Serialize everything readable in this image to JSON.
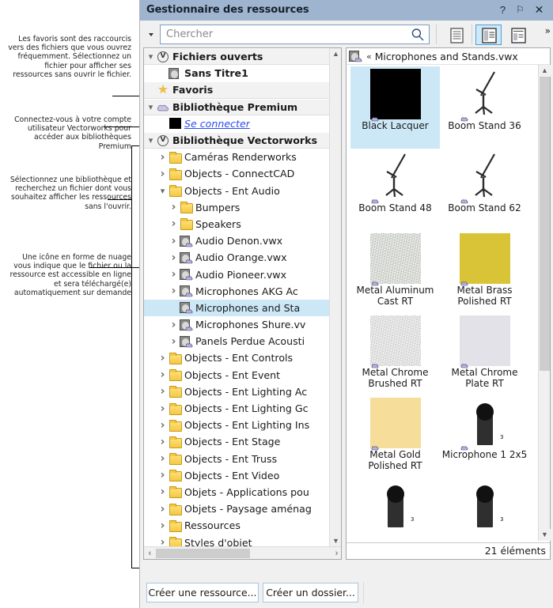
{
  "window": {
    "title": "Gestionnaire des ressources",
    "titlebar_buttons": [
      {
        "name": "help-button",
        "glyph": "?"
      },
      {
        "name": "pin-button",
        "glyph": "⚐"
      },
      {
        "name": "close-button",
        "glyph": "✕"
      }
    ]
  },
  "toolbar": {
    "search_placeholder": "Chercher",
    "search_value": "",
    "search_dropdown": "search-options-dropdown",
    "view_buttons": [
      {
        "name": "list-view-button",
        "active": false
      },
      {
        "name": "thumbnail-view-button",
        "active": true
      },
      {
        "name": "detail-view-button",
        "active": false
      }
    ],
    "overflow": "»"
  },
  "annotations": [
    {
      "id": "annot-favoris",
      "text": "Les favoris sont des raccourcis vers des fichiers que vous ouvrez fréquemment. Sélectionnez un fichier pour afficher ses ressources sans ouvrir le fichier."
    },
    {
      "id": "annot-premium",
      "text": "Connectez-vous à votre compte utilisateur Vectorworks pour accéder aux bibliothèques Premium"
    },
    {
      "id": "annot-bibliotheque",
      "text": "Sélectionnez une bibliothèque et recherchez un fichier dont vous souhaitez afficher les ressources sans l'ouvrir."
    },
    {
      "id": "annot-cloud",
      "text": "Une icône en forme de nuage vous indique que le fichier ou la ressource est accessible en ligne et sera téléchargé(e) automatiquement sur demande"
    }
  ],
  "tree": {
    "rows": [
      {
        "label": "Fichiers ouverts",
        "indent": 0,
        "twist": "open",
        "icon": "vectorworks-circle-icon",
        "group": true,
        "selected": false
      },
      {
        "label": "Sans Titre1",
        "indent": 1,
        "twist": "none",
        "icon": "vwx-document-icon",
        "group": false,
        "selected": false,
        "bold": true
      },
      {
        "label": "Favoris",
        "indent": 0,
        "twist": "none",
        "icon": "star-icon",
        "group": true,
        "selected": false
      },
      {
        "label": "Bibliothèque Premium",
        "indent": 0,
        "twist": "open",
        "icon": "cloud-icon",
        "group": true,
        "selected": false
      },
      {
        "label": "Se connecter",
        "indent": 1,
        "twist": "none",
        "icon": "black-square-icon",
        "group": false,
        "selected": false,
        "link": true
      },
      {
        "label": "Bibliothèque Vectorworks",
        "indent": 0,
        "twist": "open",
        "icon": "vectorworks-circle-icon",
        "group": true,
        "selected": false
      },
      {
        "label": "Caméras Renderworks",
        "indent": 1,
        "twist": "closed",
        "icon": "folder-icon",
        "group": false,
        "selected": false
      },
      {
        "label": "Objects - ConnectCAD",
        "indent": 1,
        "twist": "closed",
        "icon": "folder-icon",
        "group": false,
        "selected": false
      },
      {
        "label": "Objects - Ent Audio",
        "indent": 1,
        "twist": "open",
        "icon": "folder-icon",
        "group": false,
        "selected": false
      },
      {
        "label": "Bumpers",
        "indent": 2,
        "twist": "closed",
        "icon": "folder-icon",
        "group": false,
        "selected": false
      },
      {
        "label": "Speakers",
        "indent": 2,
        "twist": "closed",
        "icon": "folder-icon",
        "group": false,
        "selected": false
      },
      {
        "label": "Audio Denon.vwx",
        "indent": 2,
        "twist": "closed",
        "icon": "vwx-cloud-icon",
        "group": false,
        "selected": false
      },
      {
        "label": "Audio Orange.vwx",
        "indent": 2,
        "twist": "closed",
        "icon": "vwx-cloud-icon",
        "group": false,
        "selected": false
      },
      {
        "label": "Audio Pioneer.vwx",
        "indent": 2,
        "twist": "closed",
        "icon": "vwx-cloud-icon",
        "group": false,
        "selected": false
      },
      {
        "label": "Microphones AKG Ac",
        "indent": 2,
        "twist": "closed",
        "icon": "vwx-cloud-icon",
        "group": false,
        "selected": false
      },
      {
        "label": "Microphones and Sta",
        "indent": 2,
        "twist": "none",
        "icon": "vwx-cloud-icon",
        "group": false,
        "selected": true
      },
      {
        "label": "Microphones Shure.vv",
        "indent": 2,
        "twist": "closed",
        "icon": "vwx-cloud-icon",
        "group": false,
        "selected": false
      },
      {
        "label": "Panels Perdue Acousti",
        "indent": 2,
        "twist": "closed",
        "icon": "vwx-cloud-icon",
        "group": false,
        "selected": false
      },
      {
        "label": "Objects - Ent Controls",
        "indent": 1,
        "twist": "closed",
        "icon": "folder-icon",
        "group": false,
        "selected": false
      },
      {
        "label": "Objects - Ent Event",
        "indent": 1,
        "twist": "closed",
        "icon": "folder-icon",
        "group": false,
        "selected": false
      },
      {
        "label": "Objects - Ent Lighting Ac",
        "indent": 1,
        "twist": "closed",
        "icon": "folder-icon",
        "group": false,
        "selected": false
      },
      {
        "label": "Objects - Ent Lighting Gc",
        "indent": 1,
        "twist": "closed",
        "icon": "folder-icon",
        "group": false,
        "selected": false
      },
      {
        "label": "Objects - Ent Lighting Ins",
        "indent": 1,
        "twist": "closed",
        "icon": "folder-icon",
        "group": false,
        "selected": false
      },
      {
        "label": "Objects - Ent Stage",
        "indent": 1,
        "twist": "closed",
        "icon": "folder-icon",
        "group": false,
        "selected": false
      },
      {
        "label": "Objects - Ent Truss",
        "indent": 1,
        "twist": "closed",
        "icon": "folder-icon",
        "group": false,
        "selected": false
      },
      {
        "label": "Objects - Ent Video",
        "indent": 1,
        "twist": "closed",
        "icon": "folder-icon",
        "group": false,
        "selected": false
      },
      {
        "label": "Objets - Applications pou",
        "indent": 1,
        "twist": "closed",
        "icon": "folder-icon",
        "group": false,
        "selected": false
      },
      {
        "label": "Objets - Paysage aménag",
        "indent": 1,
        "twist": "closed",
        "icon": "folder-icon",
        "group": false,
        "selected": false
      },
      {
        "label": "Ressources",
        "indent": 1,
        "twist": "closed",
        "icon": "folder-icon",
        "group": false,
        "selected": false
      },
      {
        "label": "Styles d'objet",
        "indent": 1,
        "twist": "closed",
        "icon": "folder-icon",
        "group": false,
        "selected": false
      }
    ]
  },
  "resources": {
    "header_file": "Microphones and Stands.vwx",
    "header_back": "«",
    "status": "21 éléments",
    "items": [
      {
        "name": "Black Lacquer",
        "thumb": "solid",
        "color": "#000000",
        "selected": true,
        "cloud": true
      },
      {
        "name": "Boom Stand 36",
        "thumb": "mic-stand",
        "color": "#2b2b2b",
        "selected": false,
        "cloud": true
      },
      {
        "name": "Boom Stand 48",
        "thumb": "mic-stand",
        "color": "#2b2b2b",
        "selected": false,
        "cloud": true
      },
      {
        "name": "Boom Stand 62",
        "thumb": "mic-stand",
        "color": "#2b2b2b",
        "selected": false,
        "cloud": true
      },
      {
        "name": "Metal Aluminum Cast RT",
        "thumb": "texture",
        "color": "#c9cec4",
        "selected": false,
        "cloud": true
      },
      {
        "name": "Metal Brass Polished RT",
        "thumb": "solid",
        "color": "#d9c438",
        "selected": false,
        "cloud": true
      },
      {
        "name": "Metal Chrome Brushed RT",
        "thumb": "texture",
        "color": "#dcdcdc",
        "selected": false,
        "cloud": true
      },
      {
        "name": "Metal Chrome Plate RT",
        "thumb": "solid",
        "color": "#e2e2e8",
        "selected": false,
        "cloud": true
      },
      {
        "name": "Metal Gold Polished RT",
        "thumb": "solid",
        "color": "#f6dd9a",
        "selected": false,
        "cloud": true
      },
      {
        "name": "Microphone 1 2x5",
        "thumb": "microphone",
        "color": "#2b2b2b",
        "selected": false,
        "cloud": true
      },
      {
        "name": "",
        "thumb": "microphone",
        "color": "#2b2b2b",
        "selected": false,
        "cloud": false
      },
      {
        "name": "",
        "thumb": "microphone",
        "color": "#2b2b2b",
        "selected": false,
        "cloud": false
      }
    ]
  },
  "buttons": {
    "create_resource": "Créer une ressource...",
    "create_folder": "Créer un dossier..."
  }
}
